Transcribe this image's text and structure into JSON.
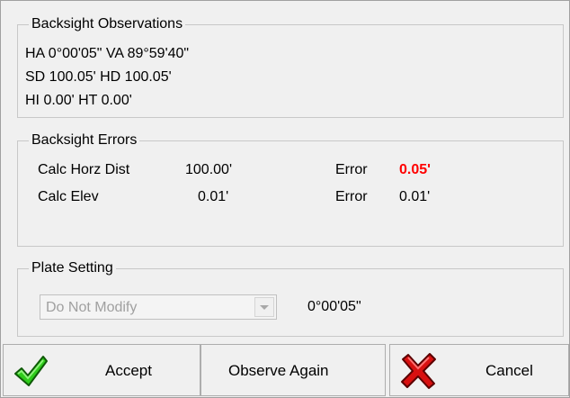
{
  "backsight_observations": {
    "title": "Backsight Observations",
    "line1": "HA 0°00'05\"  VA 89°59'40\"",
    "line2": "SD 100.05'  HD 100.05'",
    "line3": "HI 0.00'  HT 0.00'"
  },
  "backsight_errors": {
    "title": "Backsight Errors",
    "rows": [
      {
        "label": "Calc Horz Dist",
        "value": "100.00'",
        "error_label": "Error",
        "error_value": "0.05'",
        "error_highlight": true
      },
      {
        "label": "Calc Elev",
        "value": "0.01'",
        "error_label": "Error",
        "error_value": "0.01'",
        "error_highlight": false
      }
    ],
    "highlight_color": "#ff0000"
  },
  "plate_setting": {
    "title": "Plate Setting",
    "selected_option": "Do Not Modify",
    "angle_value": "0°00'05\""
  },
  "buttons": {
    "accept": {
      "label": "Accept",
      "icon": "green-checkmark-icon"
    },
    "observe_again": {
      "label": "Observe Again"
    },
    "cancel": {
      "label": "Cancel",
      "icon": "red-x-icon"
    }
  }
}
